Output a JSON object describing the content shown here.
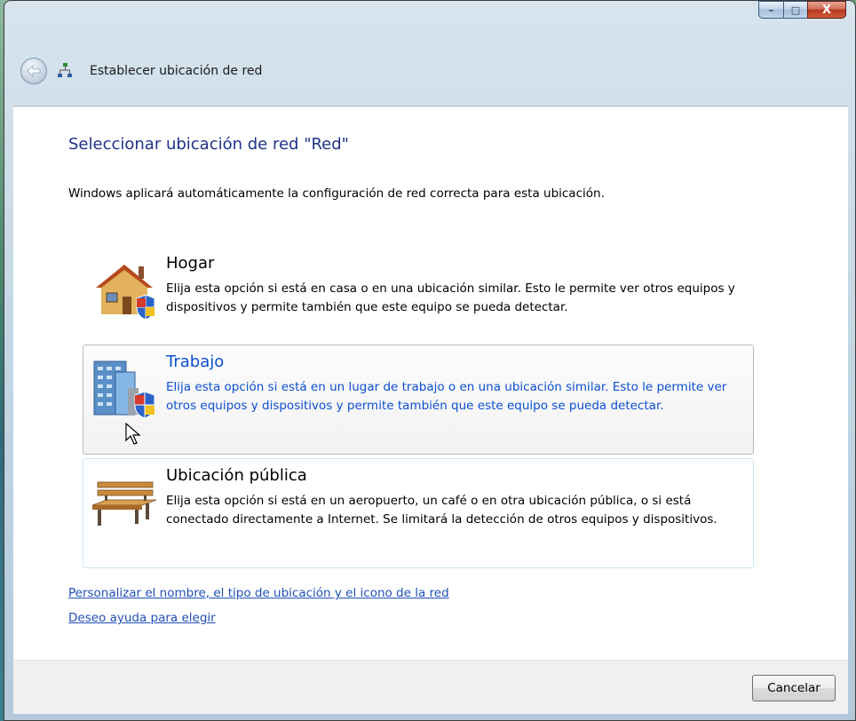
{
  "window": {
    "caption_buttons": {
      "minimize_icon": "minimize-icon",
      "maximize_icon": "maximize-icon",
      "close_icon": "close-icon",
      "minimize_glyph": "–",
      "maximize_glyph": "□",
      "close_glyph": "X"
    }
  },
  "nav": {
    "back_icon": "back-arrow-icon",
    "network_icon": "network-icon",
    "title": "Establecer ubicación de red"
  },
  "main": {
    "heading": "Seleccionar ubicación de red \"Red\"",
    "description": "Windows aplicará automáticamente la configuración de red correcta para esta ubicación.",
    "options": [
      {
        "icon": "house-shield-icon",
        "title": "Hogar",
        "description": "Elija esta opción si está en casa o en una ubicación similar. Esto le permite ver otros equipos y dispositivos y permite también que este equipo se pueda detectar."
      },
      {
        "icon": "office-building-shield-icon",
        "title": "Trabajo",
        "description": "Elija esta opción si está en un lugar de trabajo o en una ubicación similar. Esto le permite ver otros equipos y dispositivos y permite también que este equipo se pueda detectar."
      },
      {
        "icon": "park-bench-icon",
        "title": "Ubicación pública",
        "description": "Elija esta opción si está en un aeropuerto, un café o en otra ubicación pública, o si está conectado directamente a Internet. Se limitará la detección de otros equipos y dispositivos."
      }
    ],
    "links": {
      "personalize": "Personalizar el nombre, el tipo de ubicación y el icono de la red",
      "help": "Deseo ayuda para elegir"
    }
  },
  "footer": {
    "cancel_label": "Cancelar"
  },
  "colors": {
    "heading": "#1e3287",
    "link": "#1f4fb8",
    "selected_text": "#0d4fd1"
  }
}
